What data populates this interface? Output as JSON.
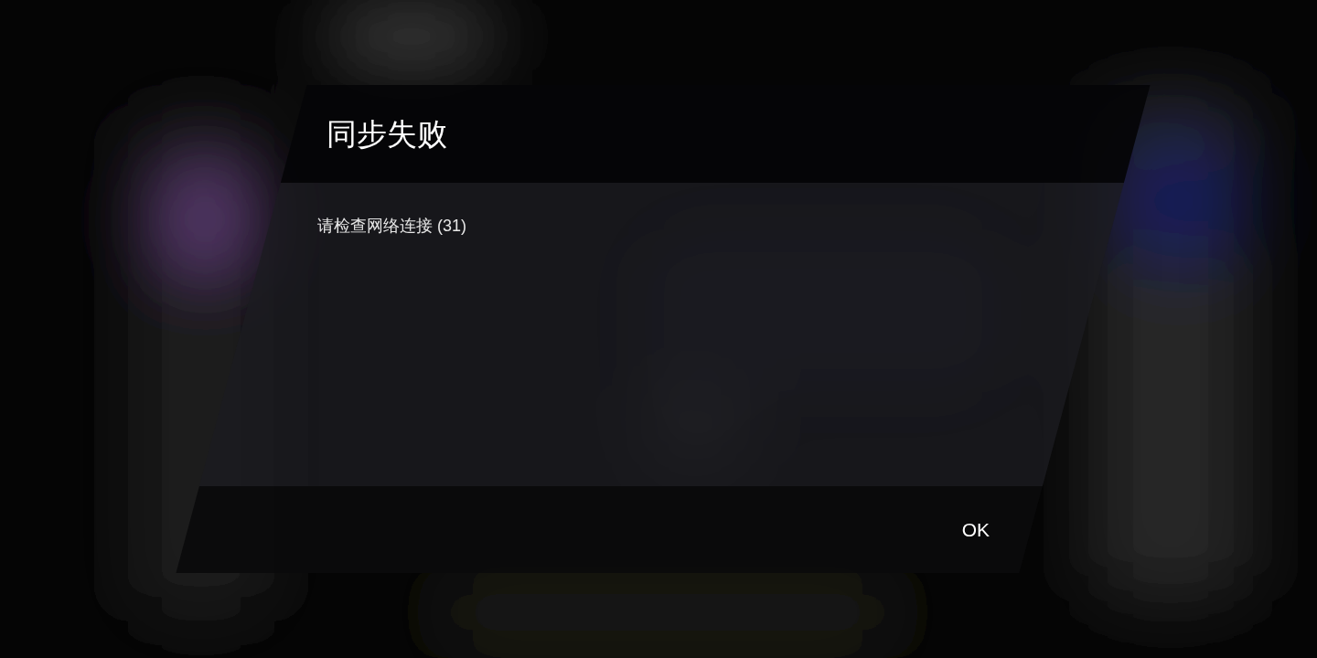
{
  "dialog": {
    "title": "同步失败",
    "message": "请检查网络连接 (31)",
    "buttons": [
      {
        "label": "OK"
      }
    ]
  }
}
